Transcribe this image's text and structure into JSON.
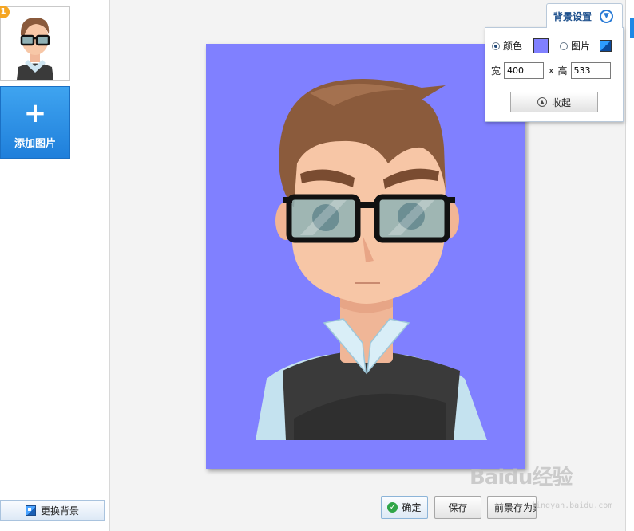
{
  "thumbnails": [
    {
      "badge": "1"
    }
  ],
  "sidebar": {
    "add_label": "添加图片",
    "add_icon": "plus-icon",
    "change_bg_label": "更换背景"
  },
  "background_panel": {
    "tab_title": "背景设置",
    "color_option_label": "颜色",
    "image_option_label": "图片",
    "selected_option": "color",
    "swatch_color": "#8080ff",
    "width_label": "宽",
    "width_value": "400",
    "times_label": "x",
    "height_label": "高",
    "height_value": "533",
    "collapse_label": "收起"
  },
  "photo": {
    "background_color": "#8080ff"
  },
  "actions": {
    "confirm_label": "确定",
    "save_label": "保存",
    "save_fg_label": "前景存为素材"
  },
  "watermark": {
    "text": "Baidu经验",
    "url": "jingyan.baidu.com"
  }
}
